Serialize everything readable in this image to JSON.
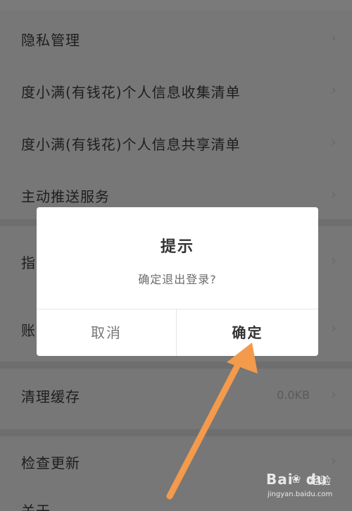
{
  "settings": {
    "items": [
      {
        "label": "隐私管理",
        "value": ""
      },
      {
        "label": "度小满(有钱花)个人信息收集清单",
        "value": ""
      },
      {
        "label": "度小满(有钱花)个人信息共享清单",
        "value": ""
      },
      {
        "label": "主动推送服务",
        "value": ""
      },
      {
        "label": "指",
        "value": ""
      },
      {
        "label": "账",
        "value": ""
      },
      {
        "label": "清理缓存",
        "value": "0.0KB"
      },
      {
        "label": "检查更新",
        "value": ""
      },
      {
        "label": "关于",
        "value": ""
      }
    ],
    "chevron": "›"
  },
  "dialog": {
    "title": "提示",
    "message": "确定退出登录?",
    "cancel_label": "取消",
    "confirm_label": "确定"
  },
  "annotation": {
    "arrow_color": "#f39a4c"
  },
  "watermark": {
    "logo": "Bai",
    "logo_suffix": "du",
    "paw_icon": "❀",
    "text": "经验",
    "url": "jingyan.baidu.com"
  }
}
